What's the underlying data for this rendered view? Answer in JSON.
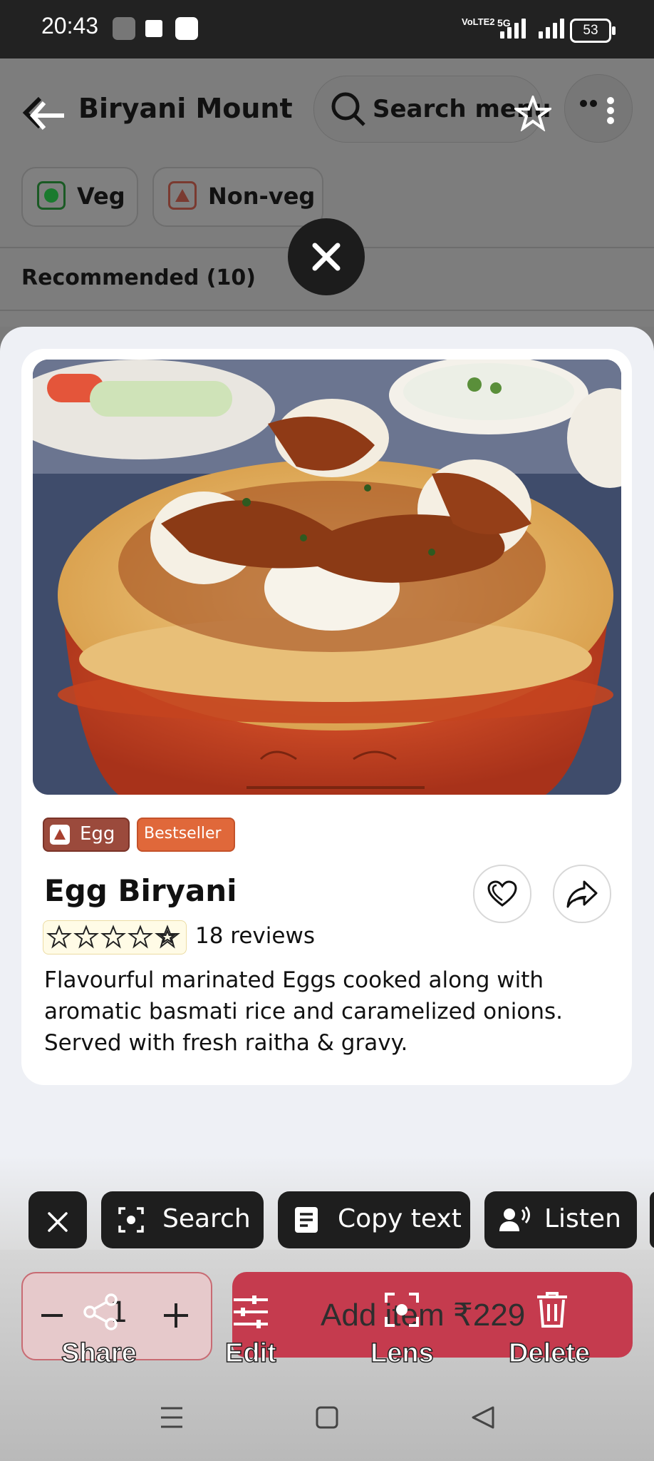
{
  "status_bar": {
    "time": "20:43",
    "network": "VoLTE2",
    "signal_label": "5G",
    "battery": "53"
  },
  "header": {
    "restaurant_name": "Biryani Mount",
    "search_placeholder": "Search menu"
  },
  "filters": [
    {
      "label": "Veg",
      "color": "#1a7a2e"
    },
    {
      "label": "Non-veg",
      "color": "#a0453a"
    }
  ],
  "section": {
    "title": "Recommended (10)"
  },
  "item": {
    "tag_type": "Egg",
    "tag_bestseller": "Bestseller",
    "name": "Egg Biryani",
    "rating_stars": 0,
    "reviews": "18 reviews",
    "description_lines": [
      "Flavourful marinated Eggs cooked along with",
      "aromatic basmati rice and caramelized onions.",
      "Served with fresh raitha & gravy."
    ]
  },
  "lens_toolbar": {
    "search": "Search",
    "copy_text": "Copy text",
    "listen": "Listen"
  },
  "cart": {
    "quantity": "1",
    "add_label": "Add item ₹229"
  },
  "screenshot_actions": {
    "share": "Share",
    "edit": "Edit",
    "lens": "Lens",
    "delete": "Delete"
  },
  "colors": {
    "accent": "#c53b4e",
    "bestseller": "#e0683a",
    "egg_badge": "#9b4a3c"
  }
}
